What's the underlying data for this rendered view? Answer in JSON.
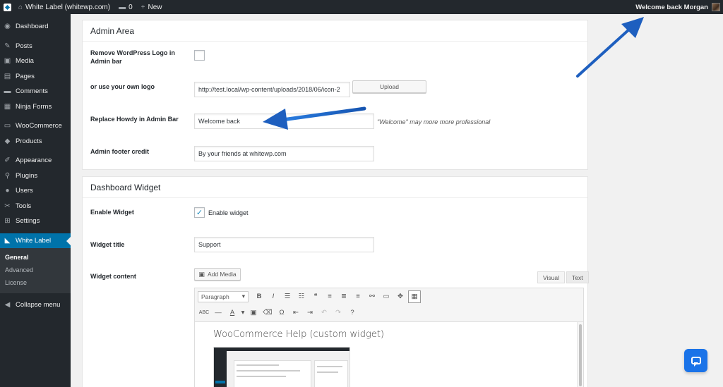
{
  "adminbar": {
    "site_title": "White Label (whitewp.com)",
    "comments_count": "0",
    "new_label": "New",
    "greeting": "Welcome back Morgan"
  },
  "sidebar": {
    "items": [
      {
        "label": "Dashboard",
        "icon": "dashboard-icon",
        "glyph": "◉"
      },
      {
        "label": "Posts",
        "icon": "pin-icon",
        "glyph": "✎"
      },
      {
        "label": "Media",
        "icon": "media-icon",
        "glyph": "▣"
      },
      {
        "label": "Pages",
        "icon": "pages-icon",
        "glyph": "▤"
      },
      {
        "label": "Comments",
        "icon": "comment-icon",
        "glyph": "▬"
      },
      {
        "label": "Ninja Forms",
        "icon": "form-icon",
        "glyph": "▦"
      },
      {
        "label": "WooCommerce",
        "icon": "woocommerce-icon",
        "glyph": "▭"
      },
      {
        "label": "Products",
        "icon": "products-icon",
        "glyph": "◆"
      },
      {
        "label": "Appearance",
        "icon": "brush-icon",
        "glyph": "✐"
      },
      {
        "label": "Plugins",
        "icon": "plugin-icon",
        "glyph": "⚲"
      },
      {
        "label": "Users",
        "icon": "user-icon",
        "glyph": "●"
      },
      {
        "label": "Tools",
        "icon": "wrench-icon",
        "glyph": "✂"
      },
      {
        "label": "Settings",
        "icon": "settings-icon",
        "glyph": "⊞"
      },
      {
        "label": "White Label",
        "icon": "tag-icon",
        "glyph": "◣"
      }
    ],
    "submenu": [
      "General",
      "Advanced",
      "License"
    ],
    "collapse_label": "Collapse menu"
  },
  "admin_area": {
    "title": "Admin Area",
    "remove_logo_label": "Remove WordPress Logo in Admin bar",
    "own_logo_label": "or use your own logo",
    "logo_url": "http://test.local/wp-content/uploads/2018/06/icon-2",
    "upload_label": "Upload",
    "howdy_label": "Replace Howdy in Admin Bar",
    "howdy_value": "Welcome back",
    "howdy_hint": "\"Welcome\" may more more professional",
    "footer_label": "Admin footer credit",
    "footer_value": "By your friends at whitewp.com"
  },
  "dashboard_widget": {
    "title": "Dashboard Widget",
    "enable_label": "Enable Widget",
    "enable_checkbox_label": "Enable widget",
    "enable_checked": true,
    "widget_title_label": "Widget title",
    "widget_title_value": "Support",
    "widget_content_label": "Widget content",
    "add_media_label": "Add Media",
    "tab_visual": "Visual",
    "tab_text": "Text",
    "format_select": "Paragraph",
    "content_heading": "WooCommerce Help (custom widget)"
  },
  "colors": {
    "accent": "#0073aa",
    "adminbar": "#23282d",
    "arrow": "#1e5fbf",
    "chat": "#1a73e8"
  }
}
